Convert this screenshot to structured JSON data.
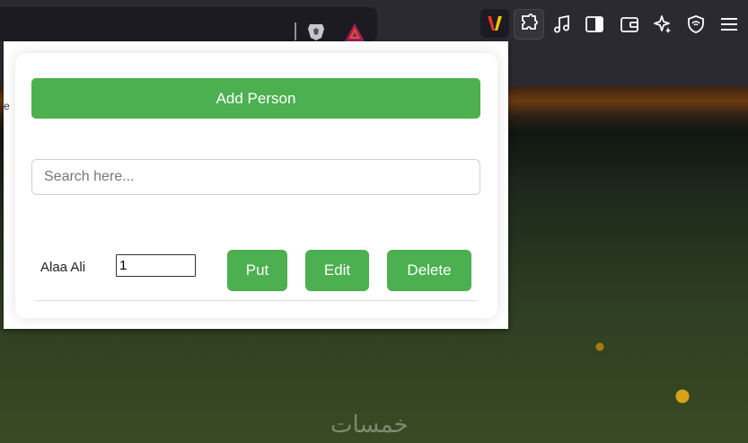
{
  "browser": {
    "extensions": [
      "brave-shields-icon",
      "brave-rewards-icon",
      "extension-active-icon",
      "extensions-puzzle-icon",
      "music-icon",
      "sidebar-icon",
      "wallet-icon",
      "leo-ai-icon",
      "vpn-icon",
      "menu-icon"
    ]
  },
  "popup": {
    "add_button_label": "Add Person",
    "search_placeholder": "Search here...",
    "search_value": "",
    "people": [
      {
        "name": "Alaa Ali",
        "quantity": "1",
        "put_label": "Put",
        "edit_label": "Edit",
        "delete_label": "Delete"
      }
    ],
    "edge_char": "e"
  },
  "colors": {
    "accent": "#4caf50",
    "toolbar": "#2b2a33"
  },
  "wallpaper": {
    "watermark": "خمسات"
  }
}
